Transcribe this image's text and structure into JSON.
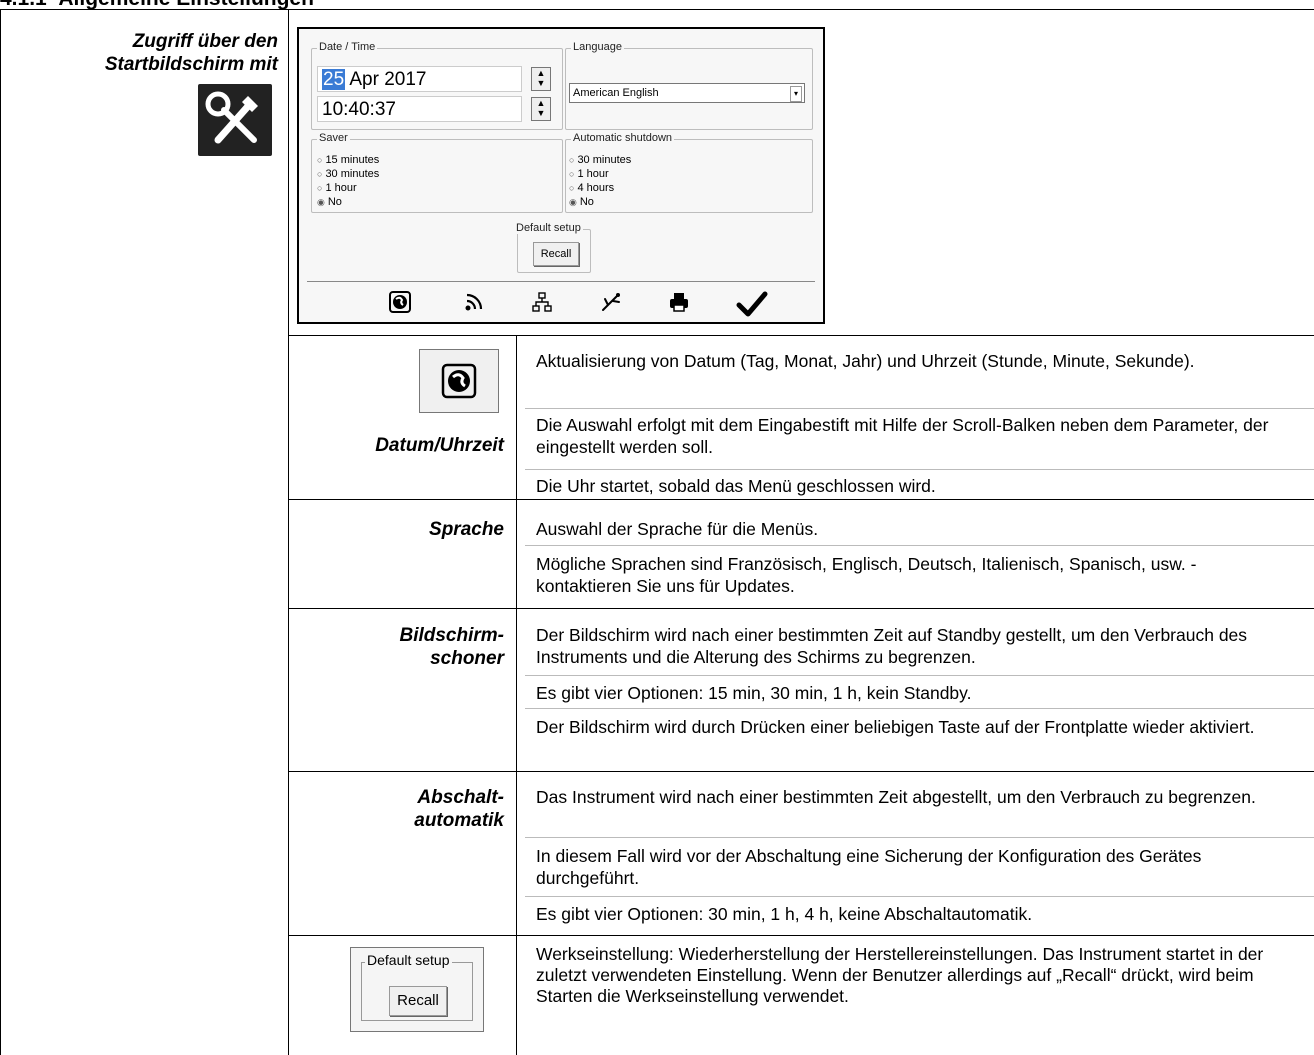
{
  "heading": "Allgemeine Einstellungen",
  "access_text_line1": "Zugriff über den",
  "access_text_line2": "Startbildschirm mit",
  "panel": {
    "datetime_group": "Date / Time",
    "date_day": "25",
    "date_rest": " Apr 2017",
    "time_value": "10:40:37",
    "language_group": "Language",
    "language_value": "American English",
    "saver_group": "Saver",
    "saver_options": [
      "15 minutes",
      "30 minutes",
      "1 hour",
      "No"
    ],
    "saver_selected": "No",
    "shutdown_group": "Automatic shutdown",
    "shutdown_options": [
      "30 minutes",
      "1 hour",
      "4 hours",
      "No"
    ],
    "shutdown_selected": "No",
    "default_group": "Default setup",
    "recall_label": "Recall",
    "toolbar_icons": [
      "globe-icon",
      "wifi-icon",
      "network-icon",
      "usb-icon",
      "printer-icon",
      "checkmark-icon"
    ]
  },
  "rows": {
    "datum": {
      "label": "Datum/Uhrzeit",
      "p1": "Aktualisierung von Datum (Tag,  Monat, Jahr) und Uhrzeit (Stunde, Minute, Sekunde).",
      "p2": "Die Auswahl erfolgt mit dem Eingabestift mit Hilfe der Scroll-Balken neben dem Parameter, der eingestellt werden soll.",
      "p3": "Die Uhr startet, sobald das Menü geschlossen wird."
    },
    "sprache": {
      "label": "Sprache",
      "p1": "Auswahl der Sprache für die Menüs.",
      "p2": "Mögliche Sprachen sind Französisch, Englisch, Deutsch, Italienisch, Spanisch, usw. - kontaktieren Sie uns für Updates."
    },
    "schoner": {
      "label1": "Bildschirm-",
      "label2": "schoner",
      "p1": "Der Bildschirm wird nach einer bestimmten Zeit auf Standby gestellt, um den Verbrauch des Instruments und die Alterung des Schirms zu begrenzen.",
      "p2": "Es gibt vier Optionen: 15 min, 30 min, 1 h, kein Standby.",
      "p3": "Der Bildschirm wird durch Drücken einer beliebigen Taste auf der Frontplatte wieder aktiviert."
    },
    "abschalt": {
      "label1": "Abschalt-",
      "label2": "automatik",
      "p1": "Das Instrument wird nach einer bestimmten Zeit abgestellt, um den Verbrauch zu begrenzen.",
      "p2": "In diesem Fall wird vor der Abschaltung eine Sicherung der Konfiguration des Gerätes durchgeführt.",
      "p3": "Es gibt vier Optionen: 30 min, 1 h, 4 h, keine Abschaltautomatik."
    },
    "werks": {
      "box_title": "Default setup",
      "box_button": "Recall",
      "p1": "Werkseinstellung: Wiederherstellung der Herstellereinstellungen. Das Instrument startet in der zuletzt verwendeten Einstellung. Wenn der Benutzer allerdings auf „Recall“ drückt, wird beim Starten die Werkseinstellung verwendet."
    }
  }
}
